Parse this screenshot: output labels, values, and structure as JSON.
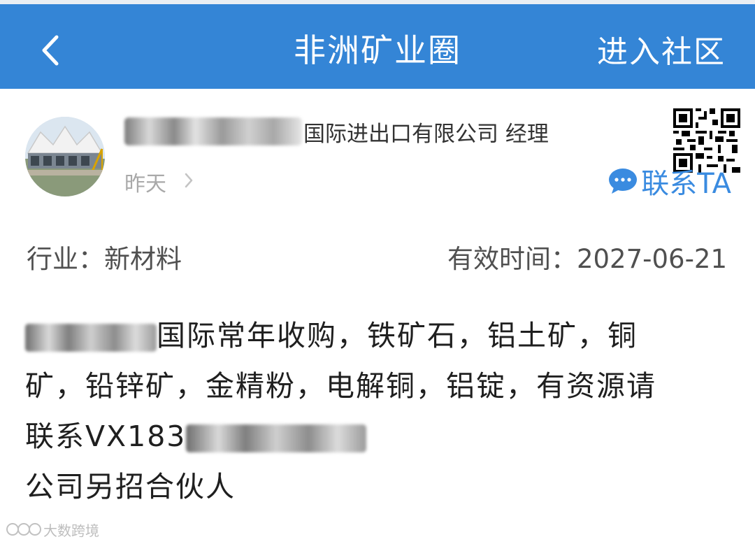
{
  "header": {
    "title": "非洲矿业圈",
    "action_label": "进入社区"
  },
  "post": {
    "poster_company": "国际进出口有限公司 经理",
    "time": "昨天",
    "contact_label": "联系TA",
    "industry": "行业：新材料",
    "valid_until": "有效时间：2027-06-21",
    "content": {
      "line1_suffix": "国际常年收购，铁矿石，铝土矿，铜",
      "line2": "矿，铅锌矿，金精粉，电解铜，铝锭，有资源请",
      "line3_prefix": "联系VX183",
      "line4": "公司另招合伙人"
    }
  },
  "watermark": {
    "text": "大数跨境"
  },
  "colors": {
    "header_bg": "#3485d6",
    "contact_blue": "#3a8be0"
  }
}
